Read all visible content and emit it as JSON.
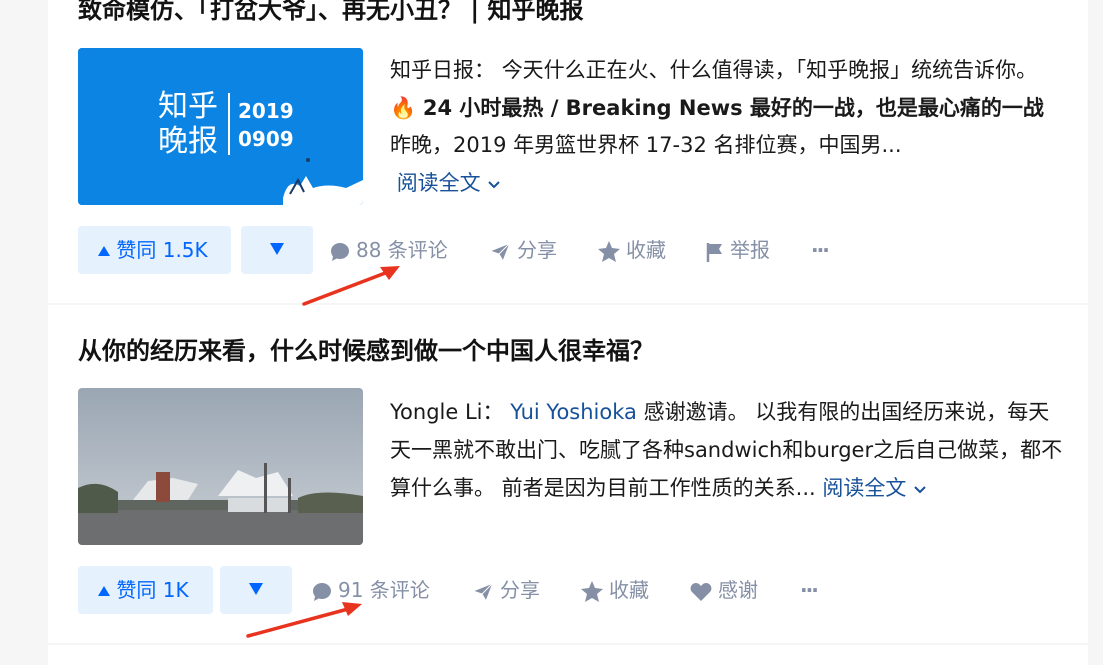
{
  "cards": [
    {
      "title": "致命模仿、「打岔大爷」、再无小丑？ | 知乎晚报",
      "thumb": {
        "line1": "知乎",
        "line2": "晚报",
        "year": "2019",
        "date": "0909"
      },
      "excerpt": {
        "author": "知乎日报：",
        "text1": "今天什么正在火、什么值得读，「知乎晚报」统统告诉你。",
        "emoji": "🔥",
        "bold": "24 小时最热 / Breaking News 最好的一战，也是最心痛的一战",
        "text2": "昨晚，2019 年男篮世界杯 17-32 名排位赛，中国男...",
        "read_more": "阅读全文"
      },
      "actions": {
        "vote_up": "赞同 1.5K",
        "comments": "88 条评论",
        "share": "分享",
        "favorite": "收藏",
        "report": "举报",
        "more": "···"
      }
    },
    {
      "title": "从你的经历来看，什么时候感到做一个中国人很幸福？",
      "excerpt": {
        "author": "Yongle Li：",
        "mention": "Yui Yoshioka",
        "text1": "感谢邀请。 以我有限的出国经历来说，每天天一黑就不敢出门、吃腻了各种sandwich和burger之后自己做菜，都不算什么事。 前者是因为目前工作性质的关系...",
        "read_more": "阅读全文"
      },
      "actions": {
        "vote_up": "赞同 1K",
        "comments": "91 条评论",
        "share": "分享",
        "favorite": "收藏",
        "thanks": "感谢",
        "more": "···"
      }
    }
  ],
  "colors": {
    "accent": "#0066ff",
    "link": "#175199",
    "muted": "#8590a6",
    "annotation": "#e8331f"
  },
  "icons": [
    "caret-up-icon",
    "caret-down-icon",
    "comment-icon",
    "share-icon",
    "star-icon",
    "flag-icon",
    "heart-icon",
    "chevron-down-icon",
    "more-icon"
  ]
}
